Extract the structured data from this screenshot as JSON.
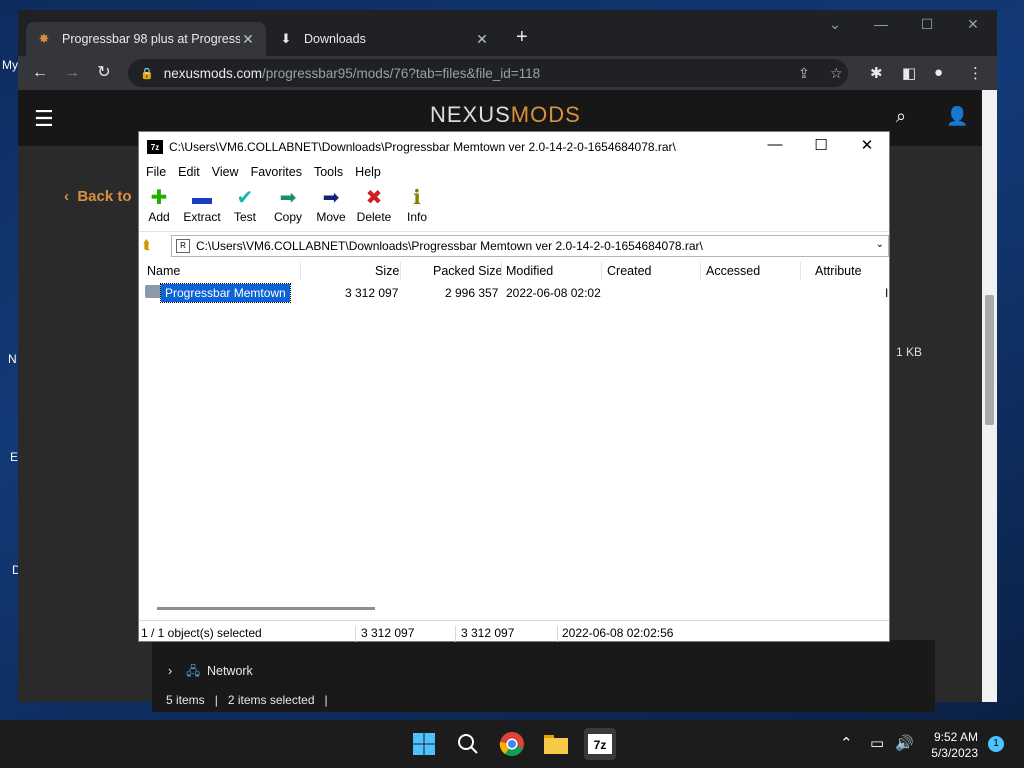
{
  "desktop": {
    "labels": [
      "My",
      "N",
      "E",
      "D"
    ]
  },
  "browser": {
    "tabs": [
      {
        "title": "Progressbar 98 plus at Progressbar",
        "icon": "nexus-favicon"
      },
      {
        "title": "Downloads",
        "icon": "download-icon"
      }
    ],
    "url_host": "nexusmods.com",
    "url_path": "/progressbar95/mods/76?tab=files&file_id=118"
  },
  "nexus": {
    "logo_main": "NEXUS",
    "logo_accent": "MODS",
    "back_link": "Back to",
    "file_size": "1 KB"
  },
  "explorer": {
    "nav_network": "Network",
    "items_count": "5 items",
    "selected_count": "2 items selected"
  },
  "sevenzip": {
    "title": "C:\\Users\\VM6.COLLABNET\\Downloads\\Progressbar Memtown ver 2.0-14-2-0-1654684078.rar\\",
    "menu": [
      "File",
      "Edit",
      "View",
      "Favorites",
      "Tools",
      "Help"
    ],
    "toolbar": [
      {
        "label": "Add",
        "icon": "add-icon",
        "glyph": "✚",
        "color": "#1db000"
      },
      {
        "label": "Extract",
        "icon": "extract-icon",
        "glyph": "▬",
        "color": "#1a3dbf"
      },
      {
        "label": "Test",
        "icon": "test-icon",
        "glyph": "✔",
        "color": "#19b3b0"
      },
      {
        "label": "Copy",
        "icon": "copy-icon",
        "glyph": "➡",
        "color": "#1e8c6e"
      },
      {
        "label": "Move",
        "icon": "move-icon",
        "glyph": "➡",
        "color": "#13237a"
      },
      {
        "label": "Delete",
        "icon": "delete-icon",
        "glyph": "✖",
        "color": "#d01f1f"
      },
      {
        "label": "Info",
        "icon": "info-icon",
        "glyph": "ℹ",
        "color": "#8a7d00"
      }
    ],
    "address": "C:\\Users\\VM6.COLLABNET\\Downloads\\Progressbar Memtown ver 2.0-14-2-0-1654684078.rar\\",
    "columns": [
      "Name",
      "Size",
      "Packed Size",
      "Modified",
      "Created",
      "Accessed",
      "Attribute"
    ],
    "rows": [
      {
        "name": "Progressbar Memtown",
        "size": "3 312 097",
        "packed": "2 996 357",
        "modified": "2022-06-08 02:02",
        "created": "",
        "accessed": "",
        "attr": "I"
      }
    ],
    "status": {
      "selected": "1 / 1 object(s) selected",
      "size": "3 312 097",
      "packed": "3 312 097",
      "modified": "2022-06-08 02:02:56"
    }
  },
  "taskbar": {
    "time": "9:52 AM",
    "date": "5/3/2023",
    "notifications": "1"
  }
}
